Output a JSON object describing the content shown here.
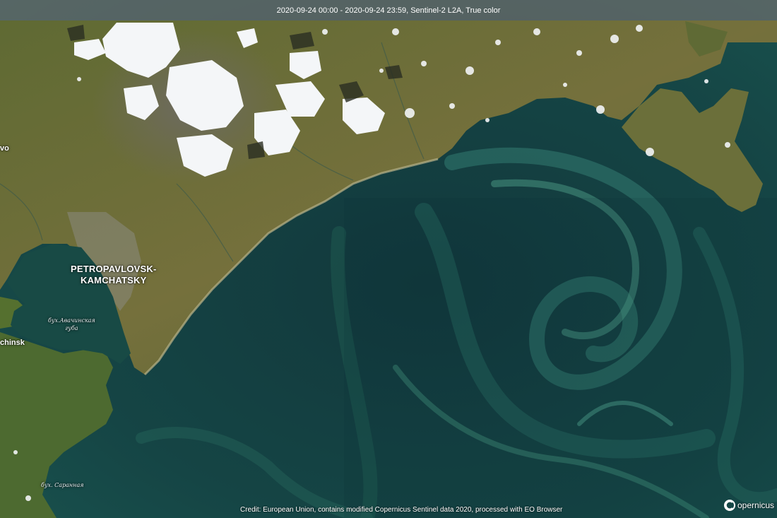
{
  "header": {
    "title": "2020-09-24 00:00 - 2020-09-24 23:59, Sentinel-2 L2A, True color"
  },
  "map": {
    "labels": {
      "city_line1": "PETROPAVLOVSK-",
      "city_line2": "KAMCHATSKY",
      "bay1_line1": "бух.Авачинская",
      "bay1_line2": "губа",
      "bay2": "бух. Саранная",
      "cut_town_top": "vo",
      "cut_town_left": "chinsk"
    },
    "colors": {
      "ocean_deep": "#0f3338",
      "ocean_bloom": "#2e7d72",
      "land": "#6e6a3a",
      "snow": "#f4f6f8"
    }
  },
  "footer": {
    "credit": "Credit: European Union, contains modified Copernicus Sentinel data 2020, processed with EO Browser",
    "logo_text": "opernicus",
    "logo_icon": "copernicus-icon"
  }
}
